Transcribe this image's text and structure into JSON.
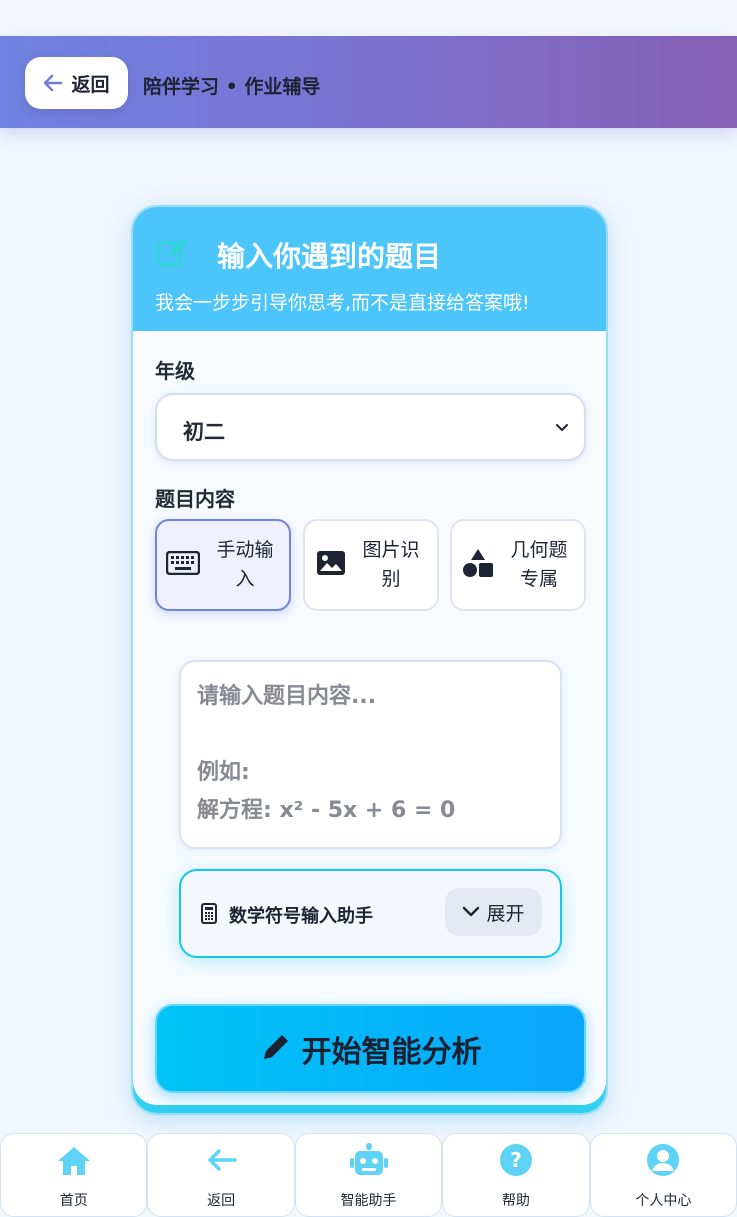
{
  "header": {
    "back_label": "返回",
    "breadcrumb": "陪伴学习 • 作业辅导"
  },
  "card": {
    "title": "输入你遇到的题目",
    "subtitle": "我会一步步引导你思考,而不是直接给答案哦!",
    "grade_label": "年级",
    "grade_value": "初二",
    "content_label": "题目内容",
    "modes": [
      {
        "label": "手动输入",
        "icon": "keyboard-icon",
        "active": true
      },
      {
        "label": "图片识别",
        "icon": "image-icon",
        "active": false
      },
      {
        "label": "几何题专属",
        "icon": "shapes-icon",
        "active": false
      }
    ],
    "textarea_placeholder": "请输入题目内容...\n\n例如:\n解方程: x² - 5x + 6 = 0",
    "math_helper_label": "数学符号输入助手",
    "expand_label": "展开",
    "analyze_label": "开始智能分析"
  },
  "bottom_nav": [
    {
      "label": "首页",
      "icon": "home-icon"
    },
    {
      "label": "返回",
      "icon": "arrow-left-icon"
    },
    {
      "label": "智能助手",
      "icon": "robot-icon"
    },
    {
      "label": "帮助",
      "icon": "help-icon"
    },
    {
      "label": "个人中心",
      "icon": "user-icon"
    }
  ],
  "colors": {
    "header_start": "#7083e0",
    "header_end": "#8560b4",
    "card_head": "#4cc5fb",
    "accent_cyan": "#00c4f7",
    "nav_icon": "#5fd3f6"
  }
}
